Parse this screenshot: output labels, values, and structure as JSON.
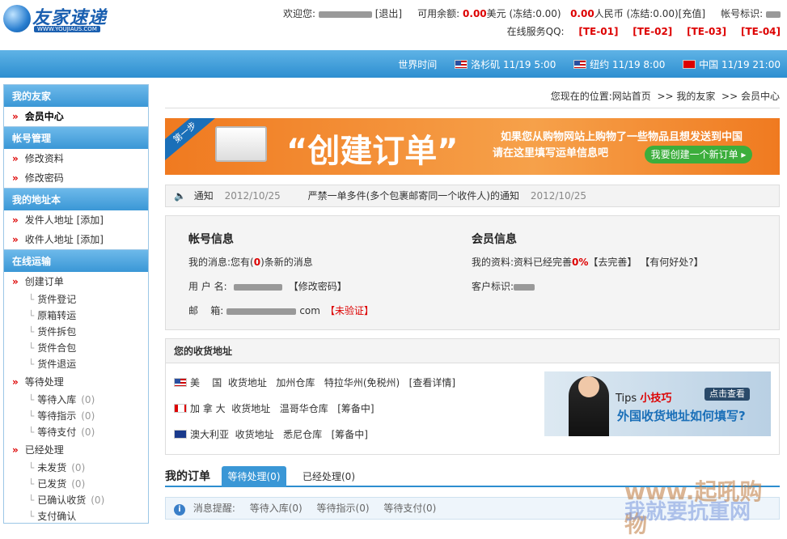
{
  "logo": {
    "text": "友家速递",
    "sub": "WWW.YOUJIAUS.COM"
  },
  "topbar": {
    "welcome": "欢迎您:",
    "logout": "[退出]",
    "balance_label": "可用余额:",
    "usd": "0.00",
    "usd_unit": "美元",
    "usd_frozen": "(冻结:0.00)",
    "cny": "0.00",
    "cny_unit": "人民币",
    "cny_frozen": "(冻结:0.00)",
    "recharge": "[充值]",
    "account_label": "帐号标识:",
    "qq_label": "在线服务QQ:",
    "qq": [
      "[TE-01]",
      "[TE-02]",
      "[TE-03]",
      "[TE-04]"
    ]
  },
  "timebar": {
    "label": "世界时间",
    "zones": [
      {
        "city": "洛杉矶",
        "time": "11/19 5:00",
        "flag": "us"
      },
      {
        "city": "纽约",
        "time": "11/19 8:00",
        "flag": "us"
      },
      {
        "city": "中国",
        "time": "11/19 21:00",
        "flag": "cn"
      }
    ]
  },
  "sidebar": {
    "my_youjia": "我的友家",
    "member_center": "会员中心",
    "account_mgmt": "帐号管理",
    "edit_profile": "修改资料",
    "edit_password": "修改密码",
    "address_book": "我的地址本",
    "sender": "发件人地址",
    "sender_add": "[添加]",
    "receiver": "收件人地址",
    "receiver_add": "[添加]",
    "online_ship": "在线运输",
    "create_order": "创建订单",
    "create_sub": [
      "货件登记",
      "原箱转运",
      "货件拆包",
      "货件合包",
      "货件退运"
    ],
    "pending": "等待处理",
    "pending_sub": [
      {
        "label": "等待入库",
        "count": "(0)"
      },
      {
        "label": "等待指示",
        "count": "(0)"
      },
      {
        "label": "等待支付",
        "count": "(0)"
      }
    ],
    "processed": "已经处理",
    "processed_sub": [
      {
        "label": "未发货",
        "count": "(0)"
      },
      {
        "label": "已发货",
        "count": "(0)"
      },
      {
        "label": "已确认收货",
        "count": "(0)"
      },
      {
        "label": "支付确认",
        "count": ""
      }
    ]
  },
  "breadcrumb": {
    "prefix": "您现在的位置:",
    "home": "网站首页",
    "sep1": ">> ",
    "friend": "我的友家",
    "sep2": ">> ",
    "member": "会员中心"
  },
  "banner": {
    "tag": "第一步",
    "title": "“创建订单”",
    "line1": "如果您从购物网站上购物了一些物品且想发送到中国",
    "line2": "请在这里填写运单信息吧",
    "button": "我要创建一个新订单 ▸"
  },
  "notice": {
    "label": "通知",
    "date1": "2012/10/25",
    "item": "严禁一单多件(多个包裹邮寄同一个收件人)的通知",
    "date2": "2012/10/25"
  },
  "account": {
    "title": "帐号信息",
    "msg_prefix": "我的消息:您有(",
    "msg_count": "0",
    "msg_suffix": ")条新的消息",
    "user_label": "用 户 名:",
    "change_pwd": "【修改密码】",
    "email_label": "邮    箱:",
    "email_tail": "com",
    "unverified": "【未验证】"
  },
  "member": {
    "title": "会员信息",
    "profile_label": "我的资料:资料已经完善",
    "profile_pct": "0%",
    "complete": "【去完善】",
    "benefit": "【有何好处?】",
    "client_label": "客户标识:"
  },
  "addresses": {
    "title": "您的收货地址",
    "rows": [
      {
        "country": "美    国",
        "type": "收货地址",
        "wh": "加州仓库",
        "info": "特拉华州(免税州)",
        "action": "[查看详情]",
        "flag": "us"
      },
      {
        "country": "加 拿 大",
        "type": "收货地址",
        "wh": "温哥华仓库",
        "info": "",
        "action": "[筹备中]",
        "flag": "ca"
      },
      {
        "country": "澳大利亚",
        "type": "收货地址",
        "wh": "悉尼仓库",
        "info": "",
        "action": "[筹备中]",
        "flag": "au"
      }
    ]
  },
  "tips": {
    "t1a": "Tips",
    "t1b": "小技巧",
    "t2": "外国收货地址如何填写?",
    "btn": "点击查看"
  },
  "orders": {
    "title": "我的订单",
    "tab1": "等待处理(0)",
    "tab2": "已经处理(0)"
  },
  "msgbar": {
    "label": "消息提醒:",
    "items": [
      "等待入库(0)",
      "等待指示(0)",
      "等待支付(0)"
    ]
  },
  "watermark": {
    "line1": "www.起吼购物",
    "line2": "我就要抗重网"
  }
}
